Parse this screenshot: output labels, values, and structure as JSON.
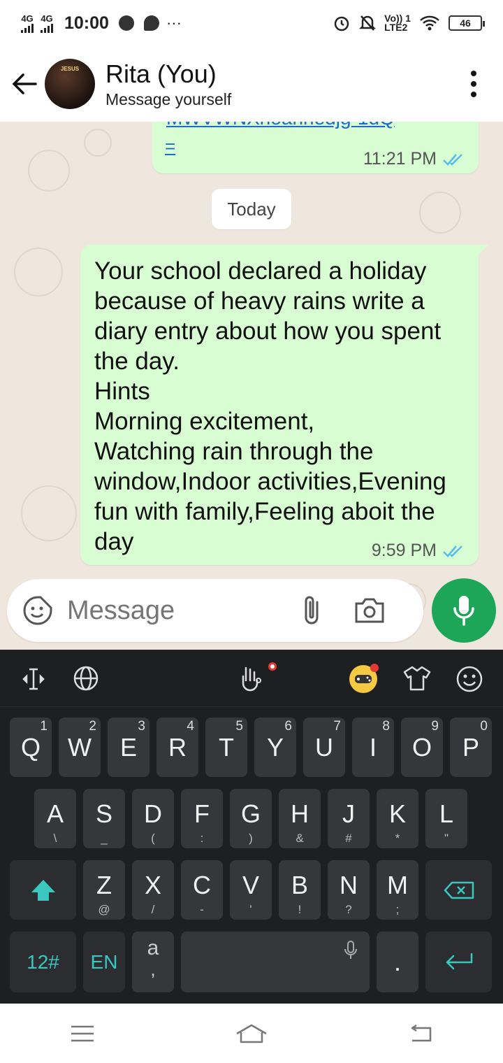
{
  "status_bar": {
    "network1": "4G",
    "network2": "4G",
    "time": "10:00",
    "more": "···",
    "volte": "Vo)) 1",
    "lte": "LTE2",
    "battery": "46"
  },
  "header": {
    "avatar_text": "JESUS",
    "name": "Rita (You)",
    "subtitle": "Message yourself"
  },
  "messages": [
    {
      "link_tail": "=",
      "time": "11:21 PM",
      "status": "read"
    },
    {
      "text": "Your school declared a holiday because of heavy rains write a diary entry about how you spent the day.\nHints\nMorning excitement,\nWatching rain through the window,Indoor activities,Evening fun with family,Feeling aboit the day",
      "time": "9:59 PM",
      "status": "read"
    }
  ],
  "date_divider": "Today",
  "composer": {
    "placeholder": "Message"
  },
  "keyboard": {
    "row1": [
      {
        "k": "Q",
        "n": "1"
      },
      {
        "k": "W",
        "n": "2"
      },
      {
        "k": "E",
        "n": "3"
      },
      {
        "k": "R",
        "n": "4"
      },
      {
        "k": "T",
        "n": "5"
      },
      {
        "k": "Y",
        "n": "6"
      },
      {
        "k": "U",
        "n": "7"
      },
      {
        "k": "I",
        "n": "8"
      },
      {
        "k": "O",
        "n": "9"
      },
      {
        "k": "P",
        "n": "0"
      }
    ],
    "row2": [
      {
        "k": "A",
        "s": "\\"
      },
      {
        "k": "S",
        "s": "_"
      },
      {
        "k": "D",
        "s": "("
      },
      {
        "k": "F",
        "s": ":"
      },
      {
        "k": "G",
        "s": ")"
      },
      {
        "k": "H",
        "s": "&"
      },
      {
        "k": "J",
        "s": "#"
      },
      {
        "k": "K",
        "s": "*"
      },
      {
        "k": "L",
        "s": "\""
      }
    ],
    "row3": [
      {
        "k": "Z",
        "s": "@"
      },
      {
        "k": "X",
        "s": "/"
      },
      {
        "k": "C",
        "s": "-"
      },
      {
        "k": "V",
        "s": "'"
      },
      {
        "k": "B",
        "s": "!"
      },
      {
        "k": "N",
        "s": "?"
      },
      {
        "k": "M",
        "s": ";"
      }
    ],
    "sym_label": "12#",
    "lang_label": "EN",
    "comma_key_top": "a",
    "comma_key_bottom": ",",
    "period_key": "."
  },
  "colors": {
    "header_bg": "#ffffff",
    "chat_bg": "#efe7de",
    "outgoing_bubble": "#d9fdd3",
    "mic_button": "#1da657",
    "link": "#1f69c9",
    "read_ticks": "#53bdeb",
    "keyboard_bg": "#1e1f21",
    "key_bg": "#35373b",
    "keyboard_accent": "#39c7c0"
  },
  "icons": {
    "back": "arrow-left-icon",
    "menu": "more-vertical-icon",
    "emoji": "sticker-icon",
    "attach": "paperclip-icon",
    "camera": "camera-icon",
    "mic": "microphone-icon"
  }
}
